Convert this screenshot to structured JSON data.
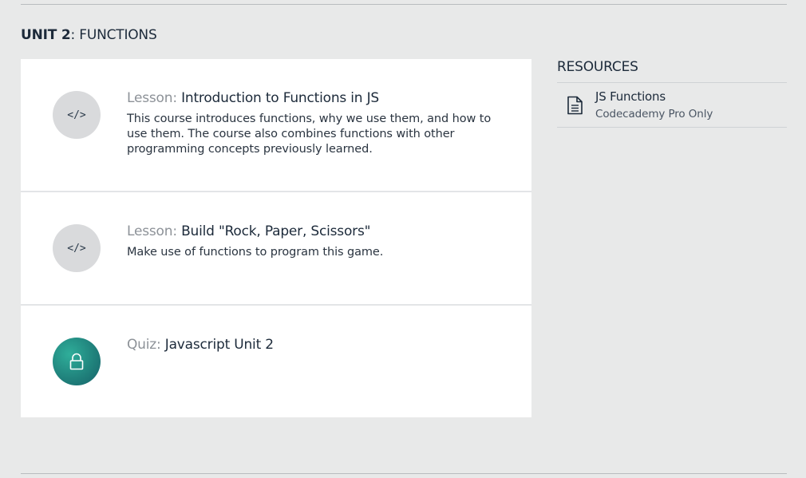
{
  "unit": {
    "label_strong": "UNIT 2",
    "label_rest": ": FUNCTIONS"
  },
  "lessons": [
    {
      "kind": "Lesson:",
      "title": "Introduction to Functions in JS",
      "description": "This course introduces functions, why we use them, and how to use them. The course also combines functions with other programming concepts previously learned.",
      "icon": "code-icon",
      "icon_glyph": "</>",
      "locked": false
    },
    {
      "kind": "Lesson:",
      "title": "Build \"Rock, Paper, Scissors\"",
      "description": "Make use of functions to program this game.",
      "icon": "code-icon",
      "icon_glyph": "</>",
      "locked": false
    },
    {
      "kind": "Quiz:",
      "title": "Javascript Unit 2",
      "description": "",
      "icon": "lock-icon",
      "locked": true
    }
  ],
  "resources": {
    "heading": "RESOURCES",
    "items": [
      {
        "title": "JS Functions",
        "subtitle": "Codecademy Pro Only",
        "icon": "document-icon"
      }
    ]
  },
  "colors": {
    "background": "#e8e9e9",
    "card": "#ffffff",
    "badge_gray": "#d9dadc",
    "lock_teal": "#1f7f7a",
    "text_dark": "#1c2a3a",
    "text_muted": "#8d9298"
  }
}
